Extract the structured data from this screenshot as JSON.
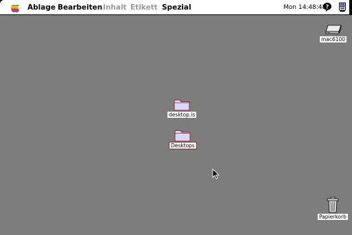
{
  "menubar": {
    "menus": [
      {
        "label": "Ablage",
        "enabled": true
      },
      {
        "label": "Bearbeiten",
        "enabled": true
      },
      {
        "label": "Inhalt",
        "enabled": false
      },
      {
        "label": "Etikett",
        "enabled": false
      },
      {
        "label": "Spezial",
        "enabled": true
      }
    ],
    "clock": "Mon 14:48:48",
    "apple_icon": "apple-logo-icon",
    "help_icon": "balloon-help-icon",
    "app_icon": "application-menu-icon"
  },
  "desktop": {
    "background_color": "#7d7d7d",
    "icons": [
      {
        "label": "mac6100",
        "icon": "hard-disk-icon"
      },
      {
        "label": "desktop.is",
        "icon": "folder-icon"
      },
      {
        "label": "Desktops",
        "icon": "folder-icon"
      },
      {
        "label": "Papierkorb",
        "icon": "trash-icon"
      }
    ]
  },
  "colors": {
    "folder_fill": "#d8d8ff",
    "folder_outline": "#8b2a2a",
    "menubar_bg": "#ffffff",
    "disabled_text": "#9a9a9a"
  }
}
